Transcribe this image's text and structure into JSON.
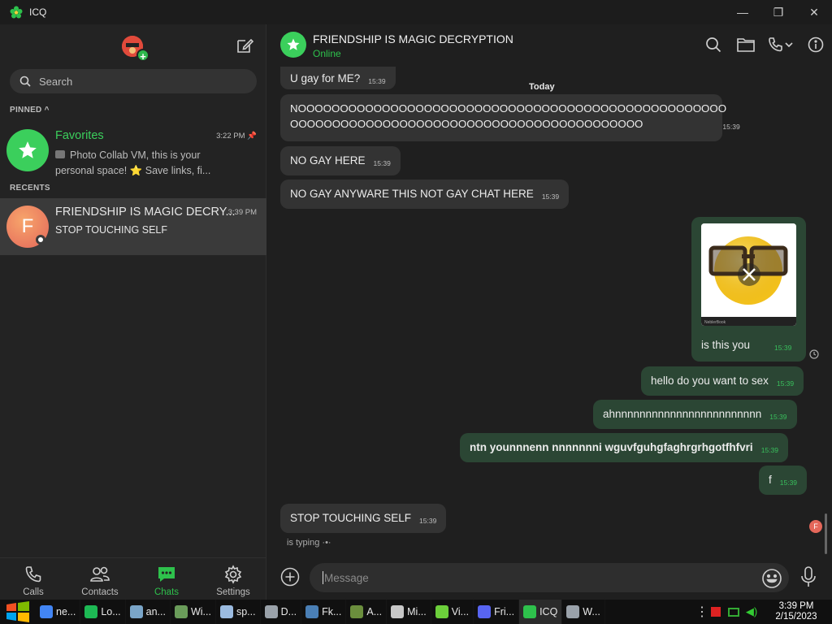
{
  "window": {
    "title": "ICQ",
    "controls": [
      "—",
      "❐",
      "✕"
    ]
  },
  "sidebar": {
    "search_placeholder": "Search",
    "pinned_label": "PINNED ^",
    "recents_label": "RECENTS",
    "chats": [
      {
        "name": "Favorites",
        "time": "3:22 PM",
        "preview_line1": "Photo Collab VM, this is your",
        "preview_line2": "personal space! ⭐ Save links, fi...",
        "accent": "#3bcf5c"
      },
      {
        "name": "FRIENDSHIP IS MAGIC DECRY...",
        "time": "3:39 PM",
        "preview_line1": "STOP TOUCHING SELF",
        "avatar_letter": "F",
        "accent": "#e4675a"
      }
    ],
    "nav": [
      {
        "label": "Calls",
        "icon": "phone-icon"
      },
      {
        "label": "Contacts",
        "icon": "contacts-icon"
      },
      {
        "label": "Chats",
        "icon": "chat-bubble-icon"
      },
      {
        "label": "Settings",
        "icon": "gear-icon"
      }
    ]
  },
  "chat": {
    "title": "FRIENDSHIP IS MAGIC DECRYPTION",
    "status": "Online",
    "day_separator": "Today",
    "messages": [
      {
        "dir": "in",
        "text": "U gay for ME?",
        "time": "15:39"
      },
      {
        "dir": "in",
        "text": "NOOOOOOOOOOOOOOOOOOOOOOOOOOOOOOOOOOOOOOOOOOOOOOOOOOO",
        "text2": "OOOOOOOOOOOOOOOOOOOOOOOOOOOOOOOOOOOOOOOOOO",
        "time": "15:39"
      },
      {
        "dir": "in",
        "text": "NO GAY HERE",
        "time": "15:39"
      },
      {
        "dir": "in",
        "text": "NO GAY ANYWARE THIS NOT GAY CHAT HERE",
        "time": "15:39"
      },
      {
        "dir": "out",
        "text": "is this you",
        "time": "15:39",
        "image_caption": "NeblerBook"
      },
      {
        "dir": "out",
        "text": "hello do you want to sex",
        "time": "15:39"
      },
      {
        "dir": "out",
        "text": "ahnnnnnnnnnnnnnnnnnnnnnnnn",
        "time": "15:39"
      },
      {
        "dir": "out",
        "text": "ntn younnnenn nnnnnnni wguvfguhgfaghrgrhgotfhfvri",
        "time": "15:39"
      },
      {
        "dir": "out",
        "text": "f",
        "time": "15:39"
      },
      {
        "dir": "in",
        "text": "STOP TOUCHING SELF",
        "time": "15:39"
      }
    ],
    "typing": "is typing ·•·",
    "mini_avatar_letter": "F",
    "composer_placeholder": "Message"
  },
  "taskbar": {
    "items": [
      {
        "label": "ne...",
        "color": "#4285f4"
      },
      {
        "label": "Lo...",
        "color": "#1db954"
      },
      {
        "label": "an...",
        "color": "#7aa5c8"
      },
      {
        "label": "Wi...",
        "color": "#6a9c5a"
      },
      {
        "label": "sp...",
        "color": "#9bbbe0"
      },
      {
        "label": "D...",
        "color": "#9aa2aa"
      },
      {
        "label": "Fk...",
        "color": "#4a7fb5"
      },
      {
        "label": "A...",
        "color": "#6b8e3d"
      },
      {
        "label": "Mi...",
        "color": "#c7c7c7"
      },
      {
        "label": "Vi...",
        "color": "#6ccf3b"
      },
      {
        "label": "Fri...",
        "color": "#5865f2"
      },
      {
        "label": "ICQ",
        "color": "#2ec14c"
      },
      {
        "label": "W...",
        "color": "#9aa2aa"
      }
    ],
    "time": "3:39 PM",
    "date": "2/15/2023"
  }
}
